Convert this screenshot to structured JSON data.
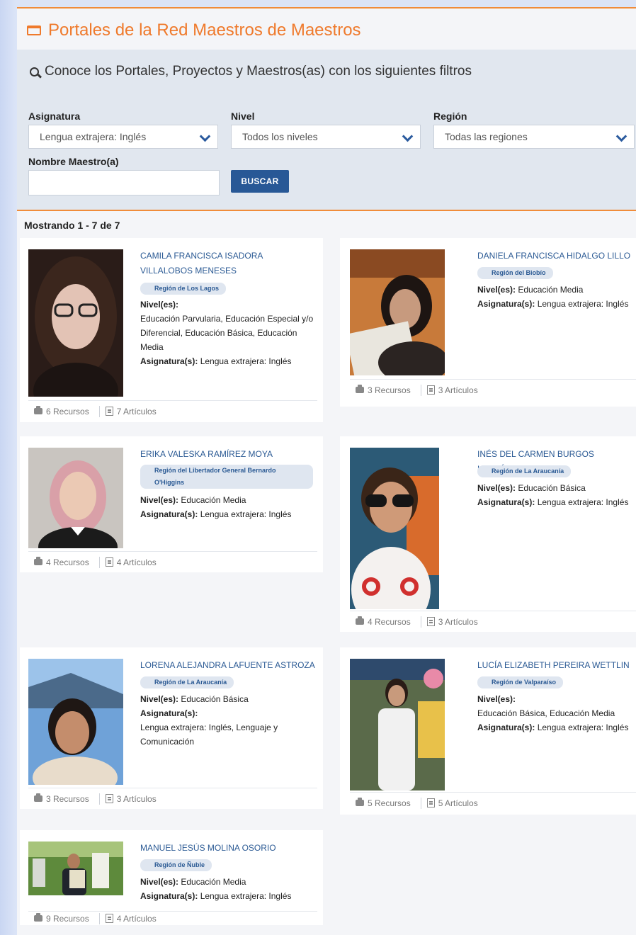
{
  "header": {
    "title": "Portales de la Red Maestros de Maestros"
  },
  "filters": {
    "heading": "Conoce los Portales, Proyectos y Maestros(as) con los siguientes filtros",
    "asignatura": {
      "label": "Asignatura",
      "value": "Lengua extrajera: Inglés"
    },
    "nivel": {
      "label": "Nivel",
      "value": "Todos los niveles"
    },
    "region": {
      "label": "Región",
      "value": "Todas las regiones"
    },
    "nombre": {
      "label": "Nombre Maestro(a)",
      "value": ""
    },
    "search_button": "BUSCAR"
  },
  "results": {
    "count_text": "Mostrando 1 - 7 de 7",
    "niveles_label": "Nivel(es):",
    "asignaturas_label": "Asignatura(s):",
    "teachers": [
      {
        "name": "CAMILA FRANCISCA ISADORA VILLALOBOS MENESES",
        "region": "Región de Los Lagos",
        "niveles": "Educación Parvularia, Educación Especial y/o Diferencial, Educación Básica, Educación Media",
        "asignaturas": "Lengua extrajera: Inglés",
        "recursos": "6 Recursos",
        "articulos": "7 Artículos"
      },
      {
        "name": "DANIELA FRANCISCA HIDALGO LILLO",
        "region": "Región del Biobío",
        "niveles": "Educación Media",
        "asignaturas": "Lengua extrajera: Inglés",
        "recursos": "3 Recursos",
        "articulos": "3 Artículos"
      },
      {
        "name": "ERIKA VALESKA RAMÍREZ MOYA",
        "region": "Región del Libertador General Bernardo O'Higgins",
        "niveles": "Educación Media",
        "asignaturas": "Lengua extrajera: Inglés",
        "recursos": "4 Recursos",
        "articulos": "4 Artículos"
      },
      {
        "name": "INÉS DEL CARMEN BURGOS HENRÍQUEZ",
        "region": "Región de La Araucanía",
        "niveles": "Educación Básica",
        "asignaturas": "Lengua extrajera: Inglés",
        "recursos": "4 Recursos",
        "articulos": "3 Artículos"
      },
      {
        "name": "LORENA ALEJANDRA LAFUENTE ASTROZA",
        "region": "Región de La Araucanía",
        "niveles": "Educación Básica",
        "asignaturas": "Lengua extrajera: Inglés, Lenguaje y Comunicación",
        "recursos": "3 Recursos",
        "articulos": "3 Artículos"
      },
      {
        "name": "LUCÍA ELIZABETH PEREIRA WETTLIN",
        "region": "Región de Valparaíso",
        "niveles": "Educación Básica, Educación Media",
        "asignaturas": "Lengua extrajera: Inglés",
        "recursos": "5 Recursos",
        "articulos": "5 Artículos"
      },
      {
        "name": "MANUEL JESÚS MOLINA OSORIO",
        "region": "Región de Ñuble",
        "niveles": "Educación Media",
        "asignaturas": "Lengua extrajera: Inglés",
        "recursos": "9 Recursos",
        "articulos": "4 Artículos"
      }
    ]
  }
}
